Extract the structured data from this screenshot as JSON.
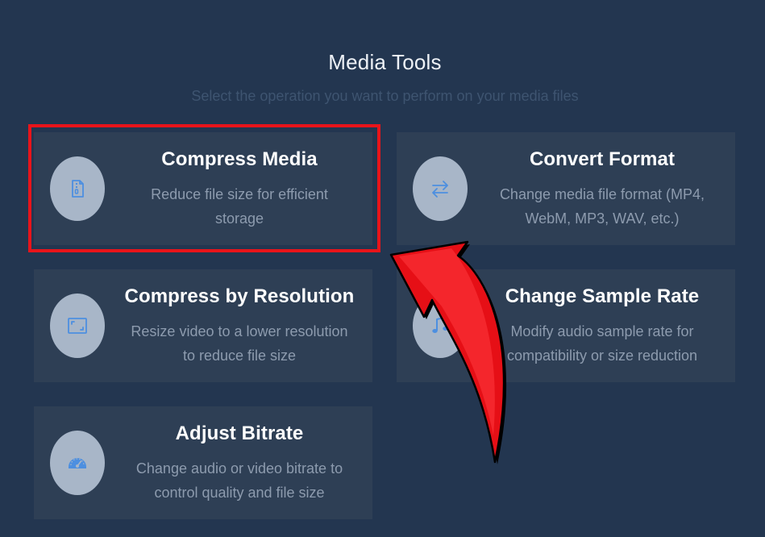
{
  "header": {
    "title": "Media Tools",
    "subtitle": "Select the operation you want to perform on your media files"
  },
  "cards": [
    {
      "title": "Compress Media",
      "description": "Reduce file size for efficient storage",
      "icon": "file-zipper-icon"
    },
    {
      "title": "Convert Format",
      "description": "Change media file format (MP4, WebM, MP3, WAV, etc.)",
      "icon": "arrows-exchange-icon"
    },
    {
      "title": "Compress by Resolution",
      "description": "Resize video to a lower resolution to reduce file size",
      "icon": "expand-frame-icon"
    },
    {
      "title": "Change Sample Rate",
      "description": "Modify audio sample rate for compatibility or size reduction",
      "icon": "music-note-icon"
    },
    {
      "title": "Adjust Bitrate",
      "description": "Change audio or video bitrate to control quality and file size",
      "icon": "gauge-icon"
    }
  ],
  "colors": {
    "background": "#233650",
    "card": "#2e3f55",
    "icon_circle": "#a8b6c8",
    "icon": "#4d8fe0",
    "highlight": "#e8141a"
  }
}
